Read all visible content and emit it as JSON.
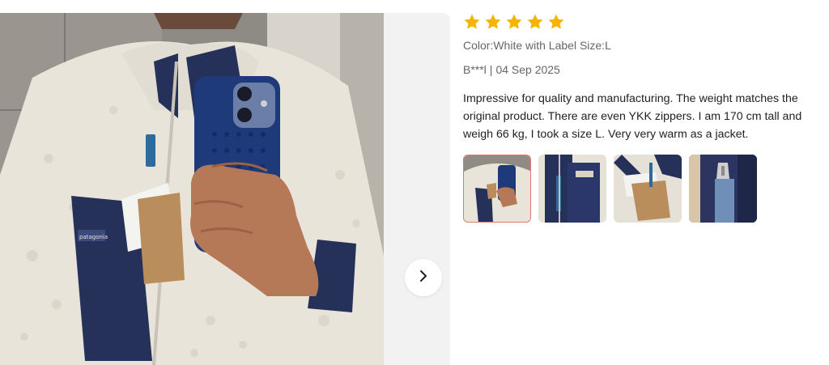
{
  "review": {
    "rating": 5,
    "star_icon": "star-icon",
    "star_color": "#f5b400",
    "variant": "Color:White with Label Size:L",
    "author": "B***l",
    "date": "04 Sep 2025",
    "separator": "|",
    "text": "Impressive for quality and manufacturing. The weight matches the original product. There are even YKK zippers. I am 170 cm tall and weigh 66 kg, I took a size L. Very very warm as a jacket."
  },
  "gallery": {
    "main_image": "review-photo-fleece-jacket-mirror-selfie",
    "next_icon": "chevron-right-icon",
    "selected_index": 0,
    "thumbnails": [
      {
        "name": "thumbnail-1"
      },
      {
        "name": "thumbnail-2"
      },
      {
        "name": "thumbnail-3"
      },
      {
        "name": "thumbnail-4"
      }
    ]
  },
  "colors": {
    "fleece": "#e9e4da",
    "navy": "#26315a",
    "selected_border": "#e07a6f"
  }
}
